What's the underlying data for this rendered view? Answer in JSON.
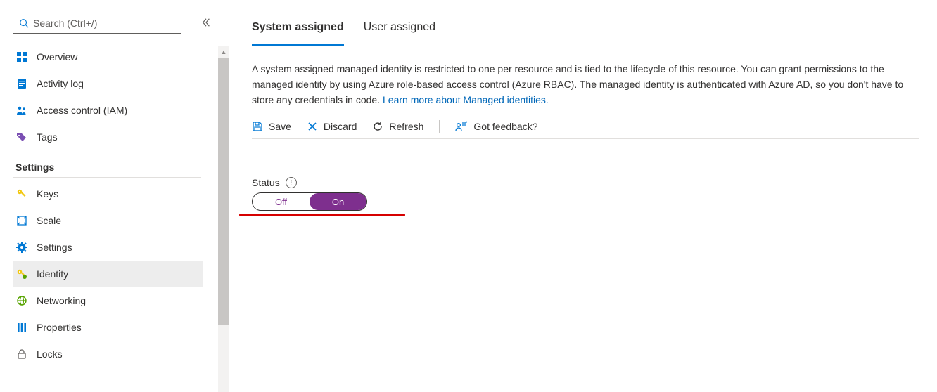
{
  "sidebar": {
    "search_placeholder": "Search (Ctrl+/)",
    "main_items": [
      {
        "label": "Overview"
      },
      {
        "label": "Activity log"
      },
      {
        "label": "Access control (IAM)"
      },
      {
        "label": "Tags"
      }
    ],
    "settings_header": "Settings",
    "settings_items": [
      {
        "label": "Keys"
      },
      {
        "label": "Scale"
      },
      {
        "label": "Settings"
      },
      {
        "label": "Identity"
      },
      {
        "label": "Networking"
      },
      {
        "label": "Properties"
      },
      {
        "label": "Locks"
      }
    ]
  },
  "tabs": {
    "system": "System assigned",
    "user": "User assigned"
  },
  "description": {
    "text": "A system assigned managed identity is restricted to one per resource and is tied to the lifecycle of this resource. You can grant permissions to the managed identity by using Azure role-based access control (Azure RBAC). The managed identity is authenticated with Azure AD, so you don't have to store any credentials in code. ",
    "link": "Learn more about Managed identities."
  },
  "toolbar": {
    "save": "Save",
    "discard": "Discard",
    "refresh": "Refresh",
    "feedback": "Got feedback?"
  },
  "status": {
    "label": "Status",
    "off": "Off",
    "on": "On",
    "value": "On"
  }
}
